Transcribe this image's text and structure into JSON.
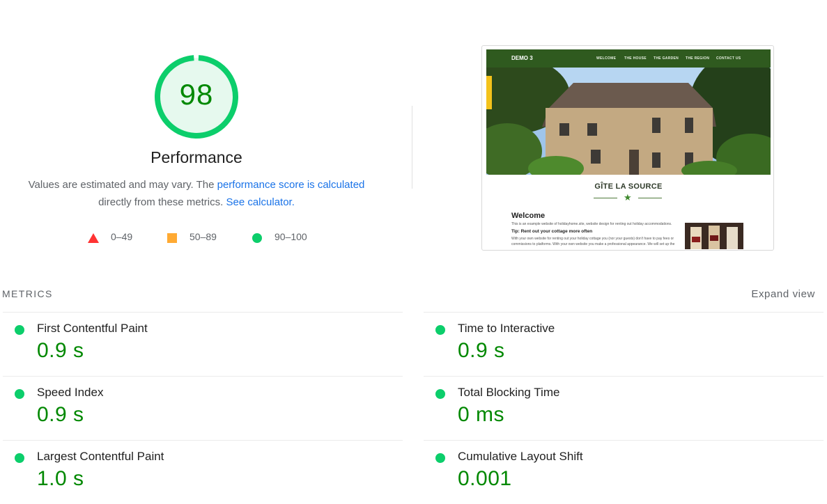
{
  "score": {
    "value": "98",
    "fraction": 0.98,
    "title": "Performance",
    "ring_color": "#0cce6b",
    "text_color": "#008800"
  },
  "description": {
    "part1": "Values are estimated and may vary. The",
    "link1": "performance score is calculated",
    "part2": "directly from these metrics.",
    "link2": "See calculator."
  },
  "legend": [
    {
      "icon": "triangle-icon",
      "label": "0–49",
      "color": "#ff3333"
    },
    {
      "icon": "square-icon",
      "label": "50–89",
      "color": "#ffaa33"
    },
    {
      "icon": "circle-icon",
      "label": "90–100",
      "color": "#0cce6b"
    }
  ],
  "thumbnail": {
    "brand": "DEMO 3",
    "nav": [
      "WELCOME",
      "THE HOUSE",
      "THE GARDEN",
      "THE REGION",
      "CONTACT US"
    ],
    "site_name": "GÎTE LA SOURCE",
    "welcome": "Welcome",
    "intro": "This is an example website of holidayhome.site, website design for renting out holiday accommodations.",
    "tip": "Tip: Rent out your cottage more often",
    "body1": "With your own website for renting out your holiday cottage you (nor your guests) don't have to pay fees or",
    "body2": "commissions to platforms. With your own website you make a professional appearance. We will set up the"
  },
  "metrics_header": {
    "label": "METRICS",
    "expand": "Expand view"
  },
  "metrics": [
    {
      "name": "First Contentful Paint",
      "value": "0.9 s"
    },
    {
      "name": "Time to Interactive",
      "value": "0.9 s"
    },
    {
      "name": "Speed Index",
      "value": "0.9 s"
    },
    {
      "name": "Total Blocking Time",
      "value": "0 ms"
    },
    {
      "name": "Largest Contentful Paint",
      "value": "1.0 s"
    },
    {
      "name": "Cumulative Layout Shift",
      "value": "0.001"
    }
  ]
}
